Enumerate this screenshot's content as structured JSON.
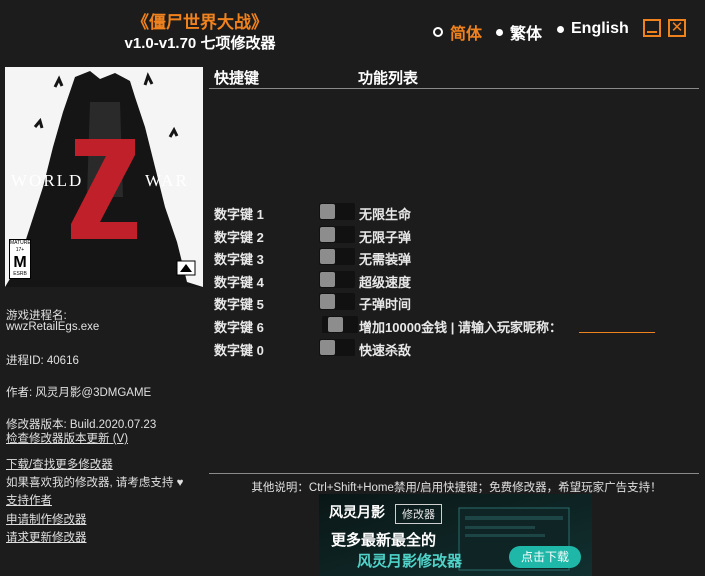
{
  "header": {
    "title": "《僵尸世界大战》",
    "subtitle": "v1.0-v1.70 七项修改器"
  },
  "languages": [
    {
      "label": "简体",
      "selected": true
    },
    {
      "label": "繁体",
      "selected": false
    },
    {
      "label": "English",
      "selected": false
    }
  ],
  "cover": {
    "title_left": "WORLD",
    "title_right": "WAR",
    "title_letter": "Z",
    "rating": "M",
    "rating_small_top": "MATURE 17+",
    "rating_small_bottom": "ESRB"
  },
  "info": {
    "process_label": "游戏进程名:",
    "process_value": "wwzRetailEgs.exe",
    "pid": "进程ID:  40616",
    "author": "作者: 风灵月影@3DMGAME",
    "version": "修改器版本:  Build.2020.07.23",
    "check_update": "检查修改器版本更新 (V)",
    "download_more": "下载/查找更多修改器",
    "support_text": "如果喜欢我的修改器, 请考虑支持",
    "support_author": "支持作者",
    "request": "申请制作修改器",
    "request_update": "请求更新修改器"
  },
  "table": {
    "col_hotkey": "快捷键",
    "col_function": "功能列表",
    "rows": [
      {
        "key": "数字键 1",
        "label": "无限生命"
      },
      {
        "key": "数字键 2",
        "label": "无限子弹"
      },
      {
        "key": "数字键 3",
        "label": "无需装弹"
      },
      {
        "key": "数字键 4",
        "label": "超级速度"
      },
      {
        "key": "数字键 5",
        "label": "子弹时间"
      },
      {
        "key": "数字键 6",
        "label": "增加10000金钱 | 请输入玩家昵称："
      },
      {
        "key": "数字键 0",
        "label": "快速杀敌"
      }
    ],
    "name_input_value": ""
  },
  "footer": {
    "note": "其他说明：Ctrl+Shift+Home禁用/启用快捷键；免费修改器，希望玩家广告支持！"
  },
  "banner": {
    "logo": "风灵月影",
    "badge": "修改器",
    "line1": "更多最新最全的",
    "line2": "风灵月影修改器",
    "button": "点击下载"
  },
  "colors": {
    "accent": "#f0821e",
    "background": "#1c1c1c",
    "cover_red": "#c0202a"
  }
}
